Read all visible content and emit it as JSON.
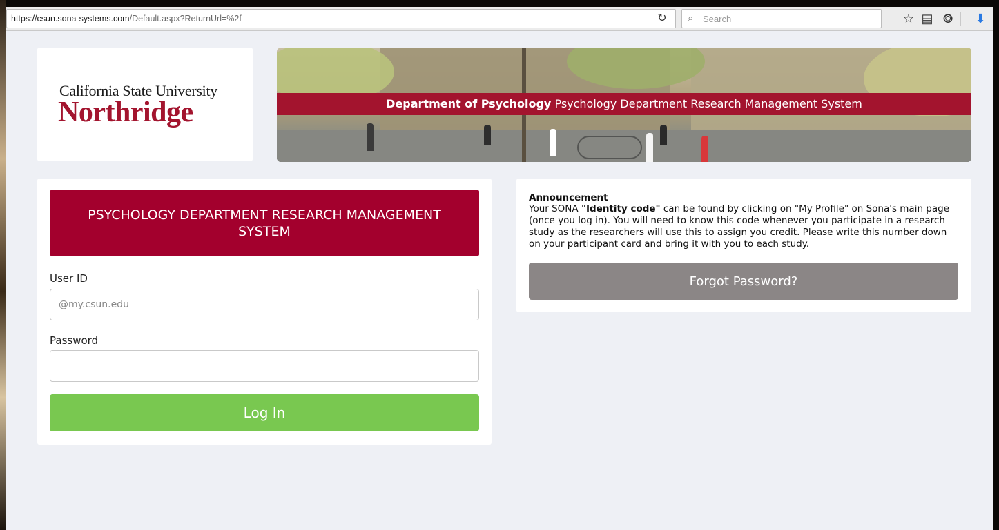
{
  "browser": {
    "url_host": "https://csun.sona-systems.com",
    "url_path": "/Default.aspx?ReturnUrl=%2f",
    "search_placeholder": "Search",
    "icons": [
      "reload-icon",
      "search-icon",
      "star-icon",
      "reading-list-icon",
      "pocket-icon",
      "download-icon"
    ]
  },
  "logo": {
    "line1": "California State University",
    "line2": "Northridge"
  },
  "banner": {
    "bold": "Department of Psychology",
    "rest": " Psychology Department Research Management System"
  },
  "login": {
    "title": "PSYCHOLOGY DEPARTMENT RESEARCH MANAGEMENT SYSTEM",
    "userid_label": "User ID",
    "userid_placeholder": "@my.csun.edu",
    "password_label": "Password",
    "login_label": "Log In"
  },
  "announcement": {
    "title": "Announcement",
    "body_pre": "Your SONA ",
    "body_bold": "\"Identity code\"",
    "body_post": " can be found by clicking on \"My Profile\" on Sona's main page (once you log in). You will need to know this code whenever you participate in a research study as the researchers will use this to assign you credit. Please write this number down on your participant card and bring it with you to each study.",
    "forgot_label": "Forgot Password?"
  },
  "colors": {
    "brand_red": "#a3002d",
    "login_green": "#79c850",
    "forgot_gray": "#8b8686",
    "page_bg": "#eef0f5"
  }
}
